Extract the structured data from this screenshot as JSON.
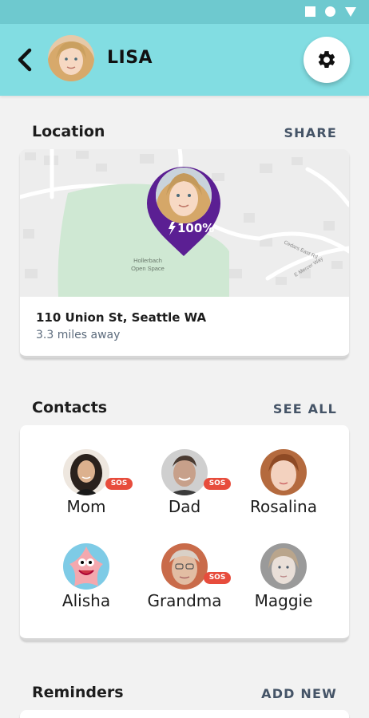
{
  "header": {
    "name": "LISA",
    "back_icon": "back-arrow-icon",
    "settings_icon": "gear-icon"
  },
  "colors": {
    "appbar": "#82dde2",
    "statusbar": "#6ec9cf",
    "pin": "#5b1f93",
    "sos": "#e74c3c",
    "park": "#cfe8d3"
  },
  "location": {
    "title": "Location",
    "action": "SHARE",
    "battery": "100%",
    "map_labels": {
      "park": "Hollerbach Open Space",
      "road1": "Cedars East Rd",
      "road2": "E Mercer Way"
    },
    "address": "110 Union St, Seattle WA",
    "distance": "3.3 miles away"
  },
  "contacts": {
    "title": "Contacts",
    "action": "SEE ALL",
    "sos_label": "SOS",
    "items": [
      {
        "name": "Mom",
        "sos": true
      },
      {
        "name": "Dad",
        "sos": true
      },
      {
        "name": "Rosalina",
        "sos": false
      },
      {
        "name": "Alisha",
        "sos": false
      },
      {
        "name": "Grandma",
        "sos": true
      },
      {
        "name": "Maggie",
        "sos": false
      }
    ]
  },
  "reminders": {
    "title": "Reminders",
    "action": "ADD NEW"
  }
}
